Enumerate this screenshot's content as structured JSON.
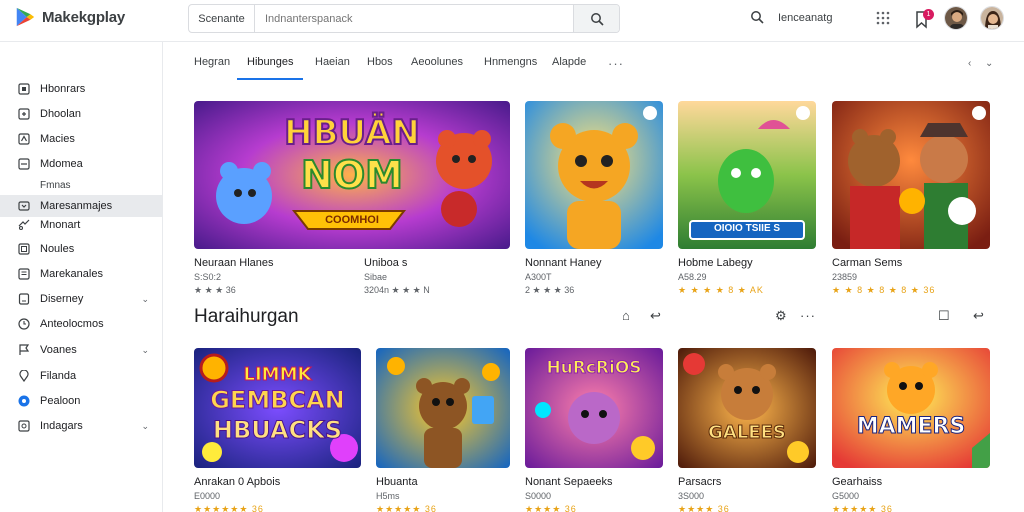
{
  "header": {
    "logo_text": "Makekgplay",
    "search_scope": "Scenante",
    "search_placeholder": "Indnanterspanack",
    "right_label": "Ienceanatg",
    "bell_badge": "1"
  },
  "sidebar": {
    "items": [
      {
        "label": "Hbonrars",
        "icon": "home-icon"
      },
      {
        "label": "Dhoolan",
        "icon": "games-icon"
      },
      {
        "label": "Macies",
        "icon": "apps-icon"
      },
      {
        "label": "Mdomea",
        "icon": "movies-icon"
      },
      {
        "label": "Fmnas",
        "icon": ""
      },
      {
        "label": "Maresanmajes",
        "icon": "books-icon"
      },
      {
        "label": "Mnonart",
        "icon": "offers-icon"
      },
      {
        "label": "Noules",
        "icon": "kids-icon"
      },
      {
        "label": "Marekanales",
        "icon": "library-icon"
      },
      {
        "label": "Diserney",
        "icon": "discover-icon"
      },
      {
        "label": "Anteolocmos",
        "icon": "clock-icon"
      },
      {
        "label": "Voanes",
        "icon": "flag-icon"
      },
      {
        "label": "Filanda",
        "icon": "pin-icon"
      },
      {
        "label": "Pealoon",
        "icon": "circle-icon"
      },
      {
        "label": "Indagars",
        "icon": "settings-icon"
      }
    ]
  },
  "tabs": [
    "Hegran",
    "Hibunges",
    "Haeian",
    "Hbos",
    "Aeoolunes",
    "Hnmengns",
    "Alapde"
  ],
  "active_tab": 1,
  "row1": [
    {
      "title": "Neuraan Hlanes",
      "sub": "S:S0:2",
      "meta": "★★★★ 36",
      "rating": 4,
      "rating_text": "★ ★ ★ 36"
    },
    {
      "title": "Uniboa s",
      "sub": "Sibae",
      "meta": "3204n ★★ N",
      "rating": 0,
      "rating_text": "3204n ★ ★ ★ N"
    },
    {
      "title": "Nonnant Haney",
      "sub": "A300T",
      "meta": "2 ★★ 36",
      "rating": 0,
      "rating_text": "2 ★ ★ ★ 36"
    },
    {
      "title": "Hobme Labegy",
      "sub": "A58.29",
      "meta": "★★★ 8 ★ AK",
      "rating": 3,
      "rating_text": "★ ★ ★ ★ 8 ★ AK"
    },
    {
      "title": "Carman Sems",
      "sub": "23859",
      "meta": "★★★ 8 ★ ★ 8 ★ 36",
      "rating": 3,
      "rating_text": "★ ★ 8 ★ 8 ★ 8 ★ 36"
    }
  ],
  "thumb_text": {
    "r1c1_title_a": "HBUÄN",
    "r1c1_title_b": "NOM",
    "r1c1_banner": "COOMHOI",
    "r1c4_bar": "OIOIO TSIIE S",
    "r2c1_a": "LIMMK",
    "r2c1_b": "GEMBCAN",
    "r2c1_c": "HBUACKS",
    "r2c3": "HuRcRiOS",
    "r2c4": "GALEES",
    "r2c5": "MAMERS"
  },
  "section": {
    "title": "Haraihurgan"
  },
  "row2": [
    {
      "title": "Anrakan 0 Apbois",
      "sub": "E0000",
      "meta": "★★★★★★ 36"
    },
    {
      "title": "Hbuanta",
      "sub": "H5ms",
      "meta": "★★★★★ 36"
    },
    {
      "title": "Nonant Sepaeeks",
      "sub": "S0000",
      "meta": "★★★★ 36"
    },
    {
      "title": "Parsacrs",
      "sub": "3S000",
      "meta": "★★★★ 36"
    },
    {
      "title": "Gearhaiss",
      "sub": "G5000",
      "meta": "★★★★★ 36"
    }
  ],
  "colors": {
    "accent": "#1a73e8",
    "star": "#e8a317",
    "badge": "#d81b60"
  }
}
